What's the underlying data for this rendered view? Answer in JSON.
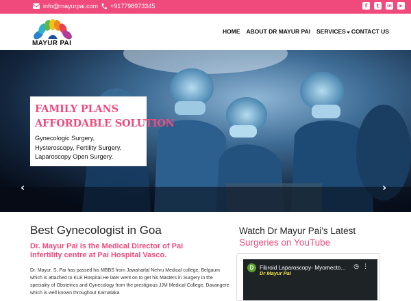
{
  "topbar": {
    "email": "info@mayurpai.com",
    "phone": "+917798973345",
    "social": [
      {
        "icon": "facebook-icon",
        "glyph": "f"
      },
      {
        "icon": "twitter-icon",
        "glyph": "t"
      },
      {
        "icon": "linkedin-icon",
        "glyph": "in"
      },
      {
        "icon": "youtube-icon",
        "glyph": "▶"
      }
    ]
  },
  "header": {
    "logo_text": "MAYUR PAI",
    "nav": {
      "home": "HOME",
      "about": "ABOUT DR MAYUR PAI",
      "services": "SERVICES",
      "contact": "CONTACT US"
    }
  },
  "hero": {
    "heading_line1": "FAMILY PLANS",
    "heading_line2": "AFFORDABLE SOLUTION",
    "services_line1": "Gynecologic Surgery,",
    "services_line2": "Hysteroscopy, Fertility Surgery,",
    "services_line3": "Laparoscopy Open Surgery.",
    "prev_glyph": "‹",
    "next_glyph": "›"
  },
  "about": {
    "title": "Best Gynecologist in Goa",
    "subtitle": "Dr. Mayur Pai is the Medical Director of Pai Infertility centre at Pai Hospital Vasco.",
    "body": "Dr. Mayur. S. Pai has passed his MBBS from Jawaharlal Nehru Medical college, Belgaum which is attached to KLE Hospital.He later went on to get his Masters in Surgery in the speciality of Obstetrics and Gynecology from the prestigious JJM Medical College, Davangere which is well known throughout Karnataka"
  },
  "video_section": {
    "title_line1": "Watch Dr Mayur Pai's Latest",
    "title_line2": "Surgeries on YouTube",
    "video_title": "Fibroid Laparoscopy- Myomecto...",
    "overlay_text": "Dr Mayur Pai",
    "channel_initial": "D"
  },
  "colors": {
    "accent": "#f04a7c",
    "hero_bg": "#0c1b2e",
    "video_bg": "#1e2326"
  }
}
